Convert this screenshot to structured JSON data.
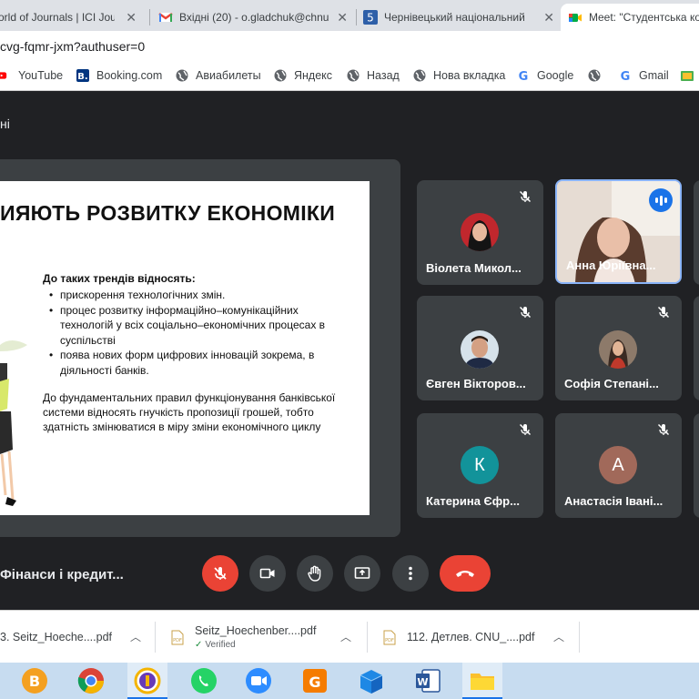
{
  "browser": {
    "tabs": [
      {
        "title": "orld of Journals | ICI Journ",
        "icon": "ici-journals-icon"
      },
      {
        "title": "Вхідні (20) - o.gladchuk@chnu",
        "icon": "gmail-icon"
      },
      {
        "title": "Чернівецький національний",
        "icon": "site-5-icon"
      },
      {
        "title": "Meet: \"Студентська ко",
        "icon": "google-meet-icon"
      }
    ],
    "url": "cvg-fqmr-jxm?authuser=0",
    "bookmarks": [
      "YouTube",
      "Booking.com",
      "Авиабилеты",
      "Яндекс",
      "Назад",
      "Нова вкладка",
      "Google",
      "Gmail"
    ]
  },
  "meet": {
    "title": "ні",
    "meeting_name": "Фінанси і кредит...",
    "slide": {
      "title": "ИЯЮТЬ РОЗВИТКУ ЕКОНОМІКИ",
      "heading": "До таких трендів відносять:",
      "bullets": [
        "прискорення технологічних змін.",
        "процес розвитку інформаційно–комунікаційних технологій у всіх соціально–економічних процесах в суспільстві",
        "поява нових форм цифрових інновацій зокрема, в діяльності банків."
      ],
      "paragraph": "До фундаментальних правил функціонування банківської системи відносять гнучкість пропозиції грошей, тобто здатність змінюватися в міру зміни економічного циклу"
    },
    "participants": [
      {
        "name": "Віолета Микол...",
        "avatar": "photo",
        "muted": true
      },
      {
        "name": "Анна Юріївна...",
        "avatar": "video",
        "speaking": true
      },
      {
        "name": "Євген Вікторов...",
        "avatar": "photo",
        "muted": true
      },
      {
        "name": "Софія Степані...",
        "avatar": "photo",
        "muted": true
      },
      {
        "name": "Катерина Єфр...",
        "avatar": "letter",
        "letter": "К",
        "color": "#12939a",
        "muted": true
      },
      {
        "name": "Анастасія Івані...",
        "avatar": "letter",
        "letter": "А",
        "color": "#a1695a",
        "muted": true
      }
    ]
  },
  "downloads": [
    {
      "name": "3. Seitz_Hoeche....pdf",
      "status": ""
    },
    {
      "name": "Seitz_Hoechenber....pdf",
      "status": "Verified"
    },
    {
      "name": "112. Детлев. CNU_....pdf",
      "status": ""
    }
  ],
  "colors": {
    "accent": "#1a73e8",
    "danger": "#ea4335",
    "meet_bg": "#202124",
    "tile_bg": "#3c4043"
  }
}
